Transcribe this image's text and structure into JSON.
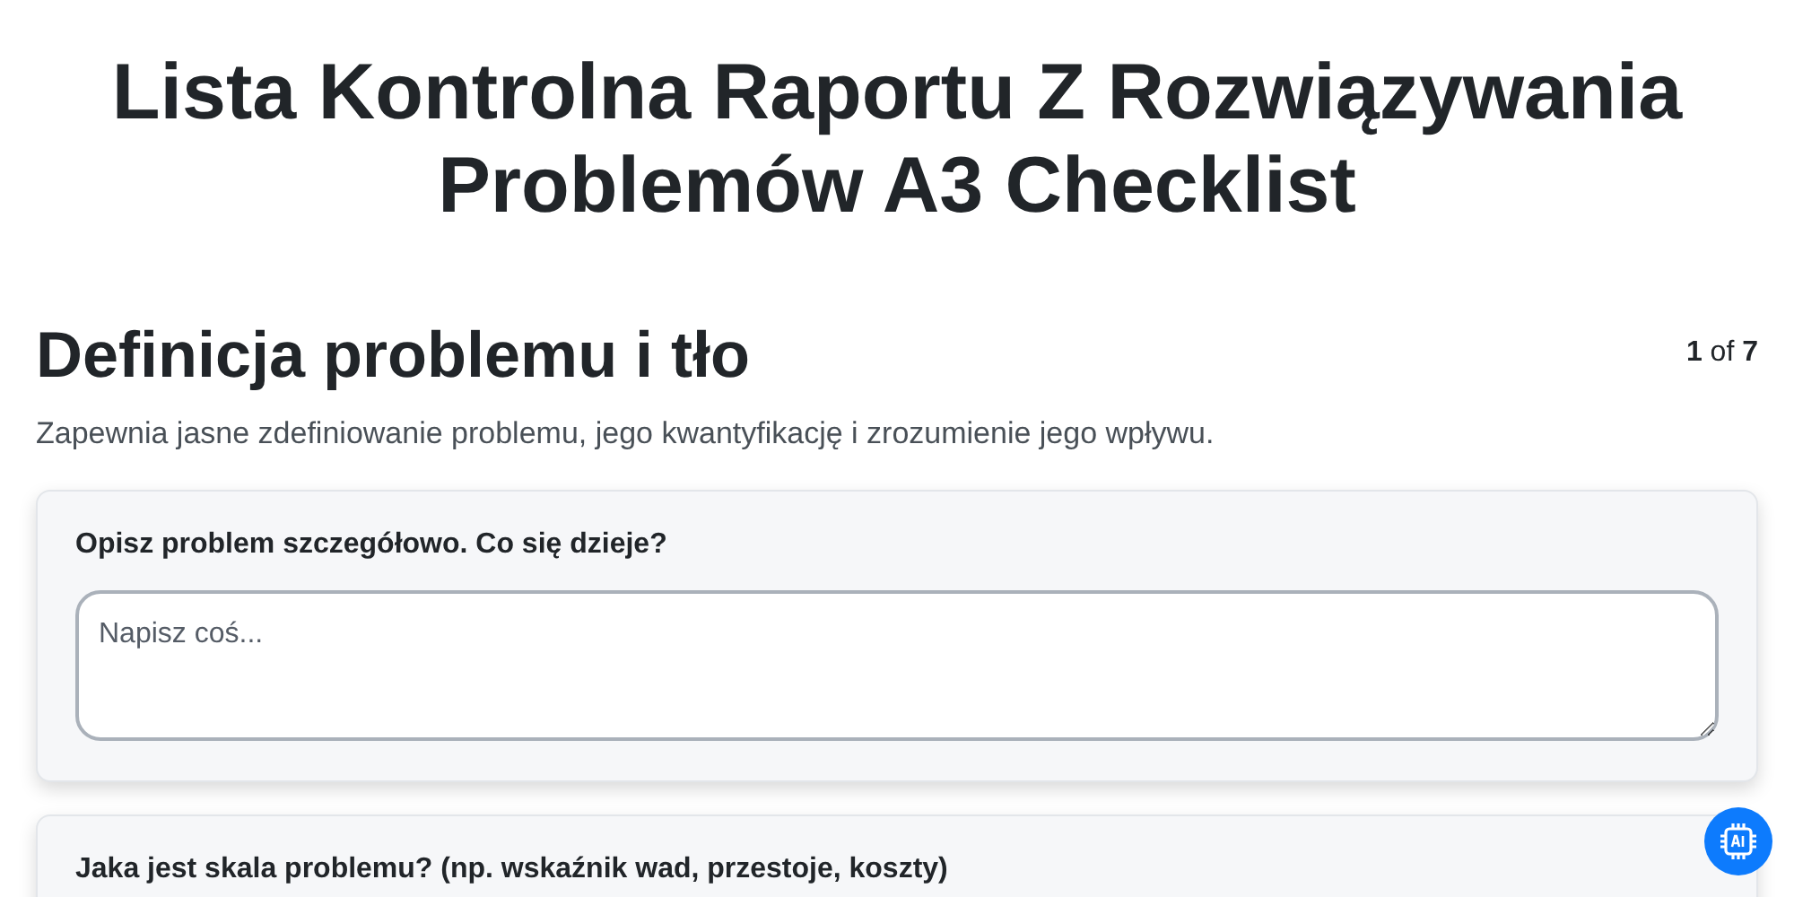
{
  "title": "Lista Kontrolna Raportu Z Rozwiązywania Problemów A3 Checklist",
  "section": {
    "heading": "Definicja problemu i tło",
    "pager": "**1** of **7**",
    "description": "Zapewnia jasne zdefiniowanie problemu, jego kwantyfikację i zrozumienie jego wpływu."
  },
  "questions": [
    {
      "label": "Opisz problem szczegółowo. Co się dzieje?",
      "placeholder": "Napisz coś..."
    },
    {
      "label": "Jaka jest skala problemu? (np. wskaźnik wad, przestoje, koszty)"
    }
  ]
}
